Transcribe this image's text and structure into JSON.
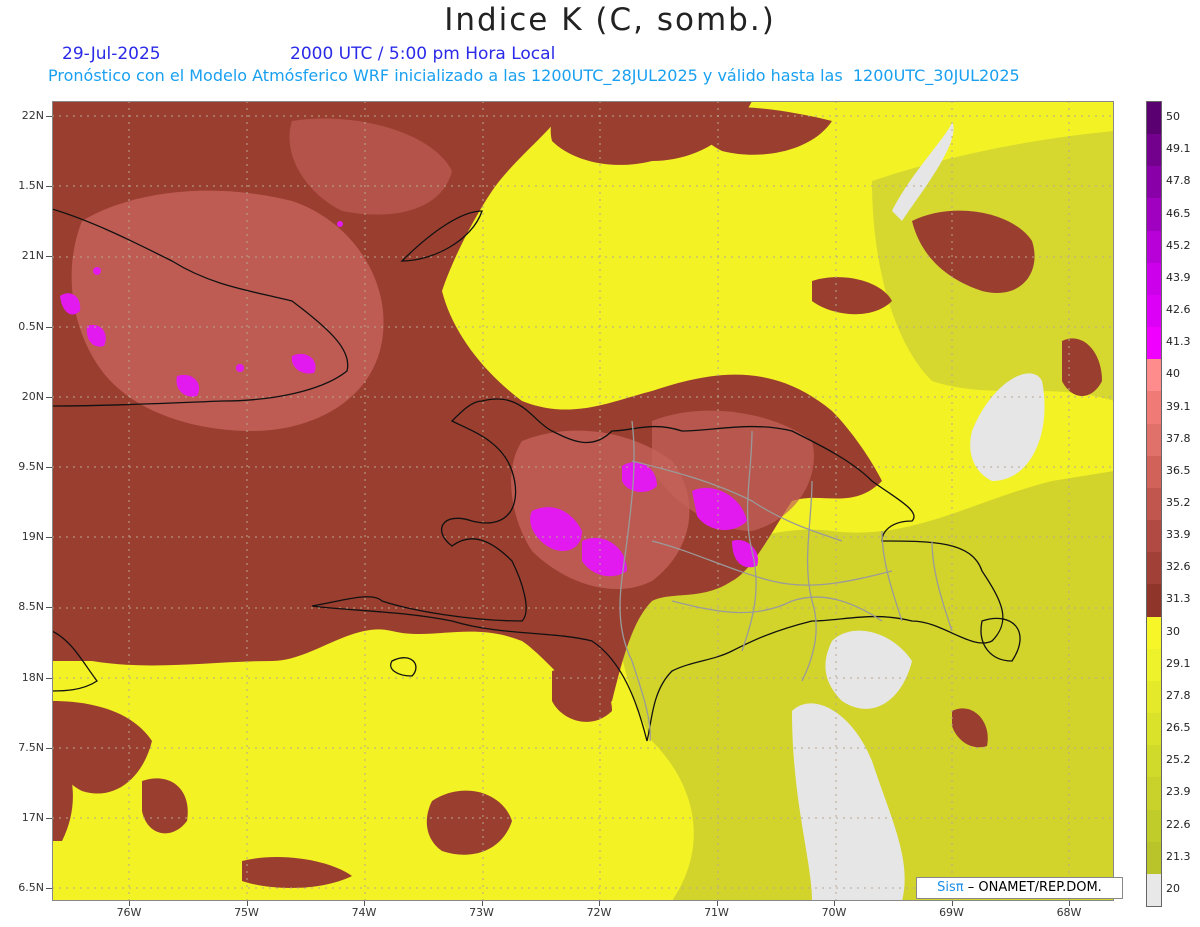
{
  "title": "Indice K (C, somb.)",
  "date": "29-Jul-2025",
  "valid_time": "2000 UTC / 5:00 pm Hora Local",
  "description": "Pronóstico con el Modelo Atmósferico WRF inicializado a las 1200UTC_28JUL2025 y válido hasta las  1200UTC_30JUL2025",
  "lat_labels": [
    "22N",
    "1.5N",
    "21N",
    "0.5N",
    "20N",
    "9.5N",
    "19N",
    "8.5N",
    "18N",
    "7.5N",
    "17N",
    "6.5N"
  ],
  "lon_labels": [
    "76W",
    "75W",
    "74W",
    "73W",
    "72W",
    "71W",
    "70W",
    "69W",
    "68W"
  ],
  "credit_logo": "Sisπ",
  "credit_text": "– ONAMET/REP.DOM.",
  "colorbar": {
    "labels": [
      "50",
      "49.1",
      "47.8",
      "46.5",
      "45.2",
      "43.9",
      "42.6",
      "41.3",
      "40",
      "39.1",
      "37.8",
      "36.5",
      "35.2",
      "33.9",
      "32.6",
      "31.3",
      "30",
      "29.1",
      "27.8",
      "26.5",
      "25.2",
      "23.9",
      "22.6",
      "21.3",
      "20"
    ],
    "colors": [
      "#5a0070",
      "#74008e",
      "#8a00a8",
      "#a000c0",
      "#b800d8",
      "#cc00ea",
      "#dd00f6",
      "#f000ff",
      "#ff8c8c",
      "#f07a76",
      "#e0706a",
      "#d0625a",
      "#c0564e",
      "#b04a42",
      "#a04036",
      "#90352a",
      "#f6f628",
      "#eef22a",
      "#e4ea2a",
      "#dae22a",
      "#d0da2a",
      "#c8d22a",
      "#c0cc2a",
      "#b8c42a",
      "#e8e8e8"
    ]
  },
  "colors": {
    "yellow": "#f2f224",
    "olive": "#cfd22c",
    "brown": "#9a3e30",
    "salmon": "#c4625a",
    "magenta": "#e21aef",
    "gray": "#e6e6e6"
  }
}
